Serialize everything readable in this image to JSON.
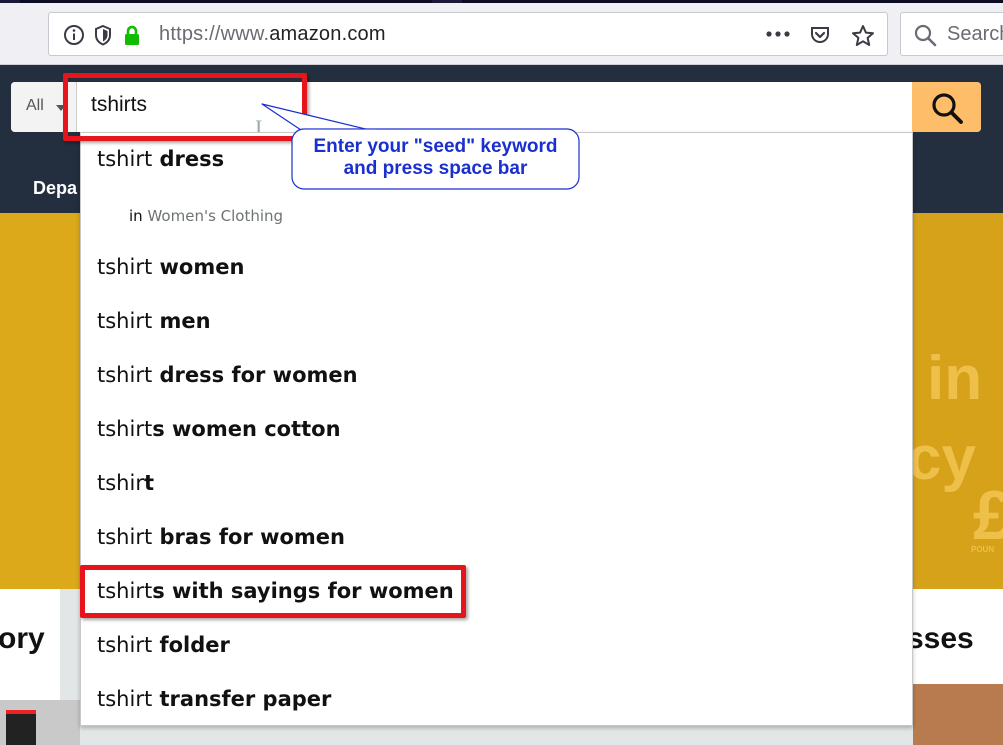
{
  "browser": {
    "url_protocol": "https://www.",
    "url_domain": "amazon.com",
    "search_placeholder": "Search",
    "icons": [
      "info-icon",
      "shield-icon",
      "lock-icon",
      "more-icon",
      "pocket-icon",
      "bookmark-star-icon",
      "search-icon"
    ],
    "lock_color": "#12bc00"
  },
  "amazon": {
    "department": "All",
    "search_value": "tshirts",
    "nav_label": "Depa",
    "search_button_color": "#febd69",
    "header_color": "#232f3e"
  },
  "suggestions": [
    {
      "typed": "tshirt",
      "completion": " dress"
    },
    {
      "typed": "tshirt",
      "completion": " women"
    },
    {
      "typed": "tshirt",
      "completion": " men"
    },
    {
      "typed": "tshirt",
      "completion": " dress for women"
    },
    {
      "typed": "tshirt",
      "completion": "s women cotton"
    },
    {
      "typed": "tshir",
      "completion": "t"
    },
    {
      "typed": "tshirt",
      "completion": " bras for women"
    },
    {
      "typed": "tshirt",
      "completion": "s with sayings for women"
    },
    {
      "typed": "tshirt",
      "completion": " folder"
    },
    {
      "typed": "tshirt",
      "completion": " transfer paper"
    }
  ],
  "suggestion_department": {
    "prefix": "in",
    "name": "Women's Clothing"
  },
  "background": {
    "hero_glyphs": [
      "in",
      "cy",
      "£"
    ],
    "hero_small": "POUN",
    "card_titles": [
      "ory",
      "sses"
    ]
  },
  "annotation": {
    "line1": "Enter your \"seed\" keyword",
    "line2": "and press space bar",
    "highlight_color": "#e8141b",
    "text_color": "#1a2fd0"
  }
}
